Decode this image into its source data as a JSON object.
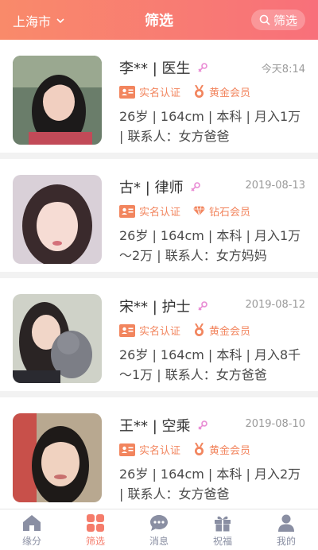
{
  "header": {
    "city": "上海市",
    "title": "筛选",
    "search_label": "筛选"
  },
  "colors": {
    "accent": "#f8707a",
    "badge": "#f2855e",
    "tab_active": "#f57c6b"
  },
  "cards": [
    {
      "name": "李** | 医生",
      "date": "今天8:14",
      "verified": "实名认证",
      "membership": "黄金会员",
      "membership_icon": "medal-icon",
      "info": "26岁 | 164cm | 本科 | 月入1万 | 联系人：女方爸爸"
    },
    {
      "name": "古* | 律师",
      "date": "2019-08-13",
      "verified": "实名认证",
      "membership": "钻石会员",
      "membership_icon": "diamond-icon",
      "info": "26岁 | 164cm | 本科 | 月入1万～2万 | 联系人：女方妈妈"
    },
    {
      "name": "宋** | 护士",
      "date": "2019-08-12",
      "verified": "实名认证",
      "membership": "黄金会员",
      "membership_icon": "medal-icon",
      "info": "26岁 | 164cm | 本科 | 月入8千～1万 | 联系人：女方爸爸"
    },
    {
      "name": "王** | 空乘",
      "date": "2019-08-10",
      "verified": "实名认证",
      "membership": "黄金会员",
      "membership_icon": "medal-icon",
      "info": "26岁 | 164cm | 本科 | 月入2万 | 联系人：女方爸爸"
    }
  ],
  "tabs": [
    {
      "label": "缘分",
      "icon": "home-icon"
    },
    {
      "label": "筛选",
      "icon": "grid-icon"
    },
    {
      "label": "消息",
      "icon": "chat-icon"
    },
    {
      "label": "祝福",
      "icon": "gift-icon"
    },
    {
      "label": "我的",
      "icon": "user-icon"
    }
  ]
}
